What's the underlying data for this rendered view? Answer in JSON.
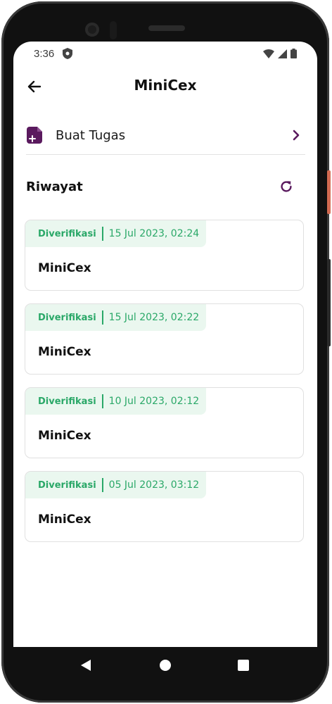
{
  "status_bar": {
    "time": "3:36"
  },
  "app_bar": {
    "title": "MiniCex"
  },
  "create_task": {
    "label": "Buat Tugas"
  },
  "history": {
    "heading": "Riwayat",
    "items": [
      {
        "status": "Diverifikasi",
        "datetime": "15 Jul 2023, 02:24",
        "name": "MiniCex"
      },
      {
        "status": "Diverifikasi",
        "datetime": "15 Jul 2023, 02:22",
        "name": "MiniCex"
      },
      {
        "status": "Diverifikasi",
        "datetime": "10 Jul 2023, 02:12",
        "name": "MiniCex"
      },
      {
        "status": "Diverifikasi",
        "datetime": "05 Jul 2023, 03:12",
        "name": "MiniCex"
      }
    ]
  },
  "colors": {
    "accent": "#5a1a5e",
    "status_green": "#2aa868",
    "badge_bg": "#eaf7ef"
  },
  "icons": {
    "back": "arrow-left-icon",
    "create": "document-plus-icon",
    "chevron": "chevron-right-icon",
    "refresh": "refresh-icon"
  }
}
